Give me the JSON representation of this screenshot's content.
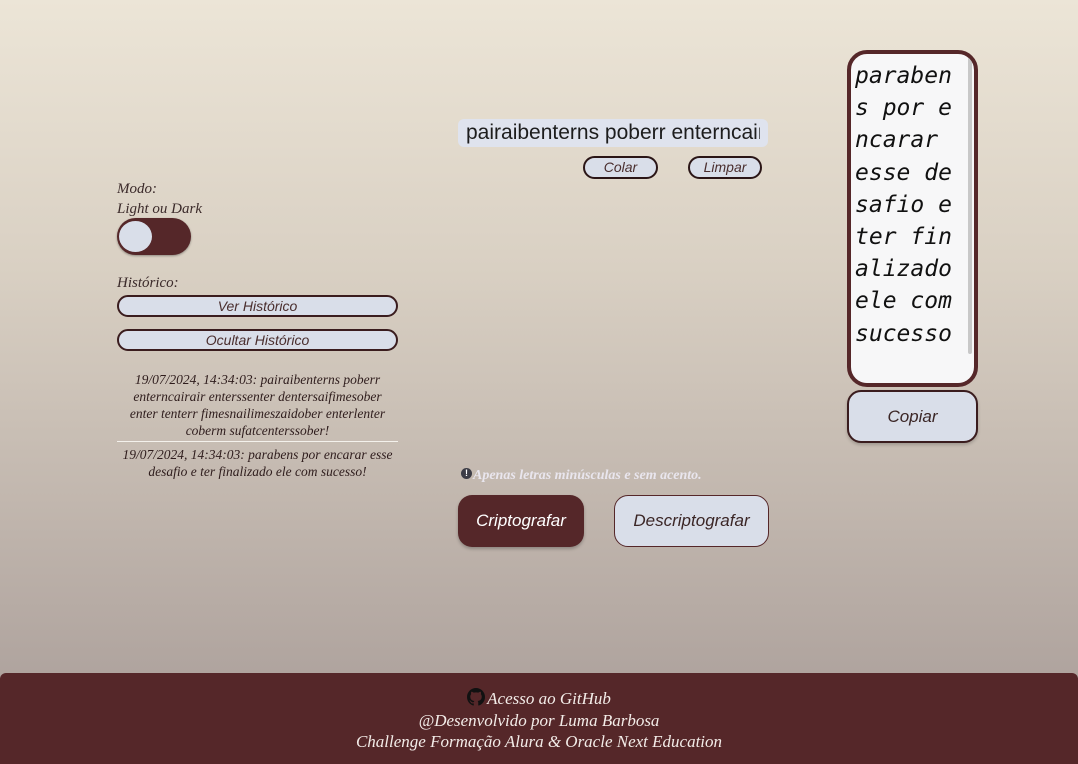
{
  "mode": {
    "label_line1": "Modo:",
    "label_line2": "Light ou Dark",
    "toggle_state": "light"
  },
  "history": {
    "label": "Histórico:",
    "show_button": "Ver Histórico",
    "hide_button": "Ocultar Histórico",
    "entries": [
      "19/07/2024, 14:34:03: pairaibenterns poberr enterncairair enterssenter dentersaifimesober enter tenterr fimesnailimeszaidober enterlenter coberm sufatcenterssober!",
      "19/07/2024, 14:34:03: parabens por encarar esse desafio e ter finalizado ele com sucesso!"
    ]
  },
  "input": {
    "value": "pairaibenterns poberr enterncairair enterssenter dentersaifimesober",
    "paste_button": "Colar",
    "clear_button": "Limpar"
  },
  "notice": {
    "text": "Apenas letras minúsculas e sem acento.",
    "icon": "info-icon"
  },
  "actions": {
    "encrypt_button": "Criptografar",
    "decrypt_button": "Descriptografar"
  },
  "output": {
    "text": "parabens por encarar esse desafio e ter finalizado ele com sucesso",
    "copy_button": "Copiar"
  },
  "footer": {
    "github_link": "Acesso ao GitHub",
    "credit": "@Desenvolvido por Luma Barbosa",
    "challenge": "Challenge Formação Alura & Oracle Next Education"
  },
  "colors": {
    "primary": "#552729",
    "button_bg": "#d9dee9",
    "notice": "#e9e6ee"
  }
}
